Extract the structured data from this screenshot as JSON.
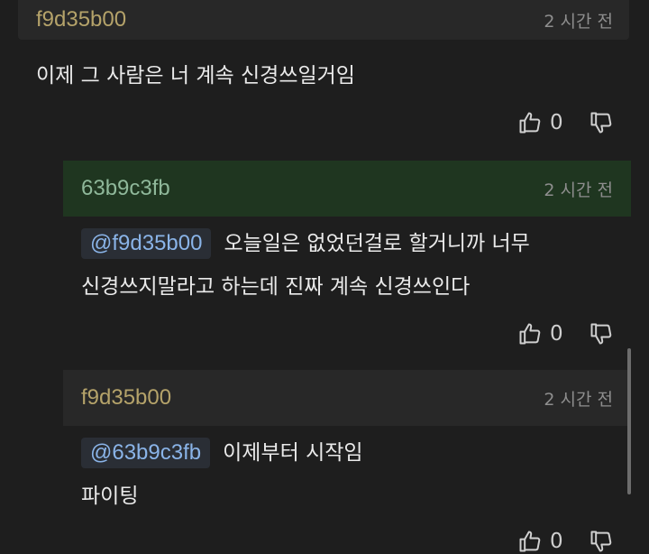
{
  "comments": [
    {
      "username": "f9d35b00",
      "time": "2 시간 전",
      "text": "이제 그 사람은 너 계속 신경쓰일거임",
      "likes": "0",
      "username_color": "#b5a36a",
      "header_bg": "#282828"
    },
    {
      "username": "63b9c3fb",
      "time": "2 시간 전",
      "mention": "@f9d35b00",
      "text_line1": "오늘일은 없었던걸로 할거니까 너무",
      "text_line2": "신경쓰지말라고 하는데 진짜 계속 신경쓰인다",
      "likes": "0",
      "username_color": "#8fb89a",
      "header_bg": "#1f3620"
    },
    {
      "username": "f9d35b00",
      "time": "2 시간 전",
      "mention": "@63b9c3fb",
      "text_line1": "이제부터 시작임",
      "text_line2": "파이팅",
      "likes": "0",
      "username_color": "#b5a36a",
      "header_bg": "#282828"
    }
  ]
}
